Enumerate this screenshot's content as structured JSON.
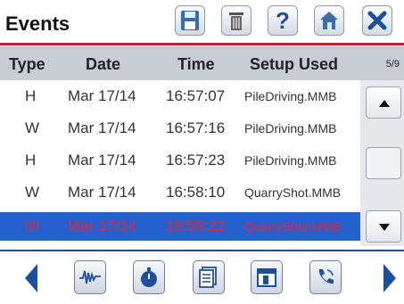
{
  "title": "Events",
  "toolbar": {
    "save_icon": "save-icon",
    "delete_icon": "trash-icon",
    "help_label": "?",
    "home_icon": "home-icon",
    "close_icon": "close-icon"
  },
  "table": {
    "headers": {
      "type": "Type",
      "date": "Date",
      "time": "Time",
      "setup": "Setup Used"
    },
    "page_indicator": "5/9",
    "rows": [
      {
        "type": "H",
        "date": "Mar 17/14",
        "time": "16:57:07",
        "setup": "PileDriving.MMB"
      },
      {
        "type": "W",
        "date": "Mar 17/14",
        "time": "16:57:16",
        "setup": "PileDriving.MMB"
      },
      {
        "type": "H",
        "date": "Mar 17/14",
        "time": "16:57:23",
        "setup": "PileDriving.MMB"
      },
      {
        "type": "W",
        "date": "Mar 17/14",
        "time": "16:58:10",
        "setup": "QuarryShot.MMB"
      },
      {
        "type": "W",
        "date": "Mar 17/14",
        "time": "16:58:22",
        "setup": "QuarryShot.MMB"
      }
    ],
    "selected_row": 4
  },
  "colors": {
    "accent_red": "#c0202a",
    "selection_blue": "#2461cf",
    "nav_blue": "#1d4fa0"
  }
}
